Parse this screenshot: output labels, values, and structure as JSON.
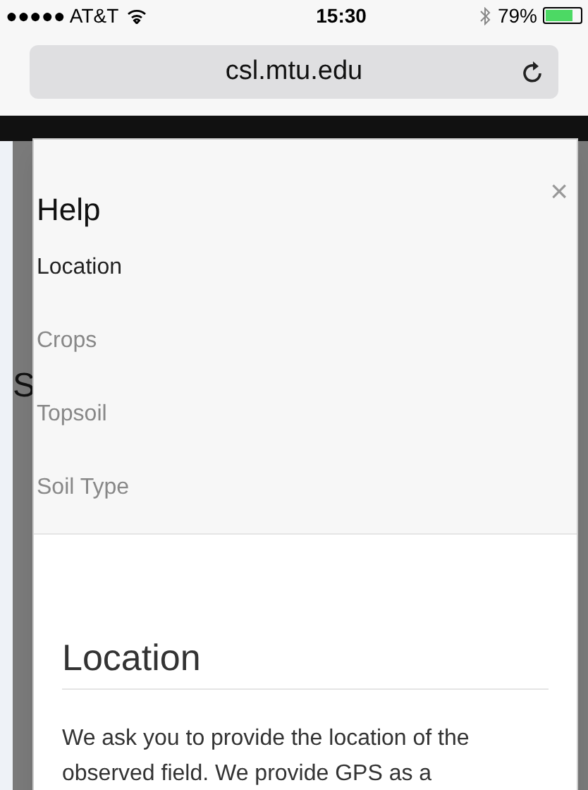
{
  "status_bar": {
    "carrier": "●●●●● AT&T",
    "time": "15:30",
    "battery": "79%"
  },
  "address_bar": {
    "url": "csl.mtu.edu"
  },
  "background_heading": "S",
  "modal": {
    "title": "Help",
    "close": "×",
    "nav_items": [
      {
        "label": "Location",
        "selected": true
      },
      {
        "label": "Crops",
        "selected": false
      },
      {
        "label": "Topsoil",
        "selected": false
      },
      {
        "label": "Soil Type",
        "selected": false
      }
    ],
    "section_heading": "Location",
    "paragraph": "We ask you to provide the location of the observed field. We provide GPS as a"
  }
}
